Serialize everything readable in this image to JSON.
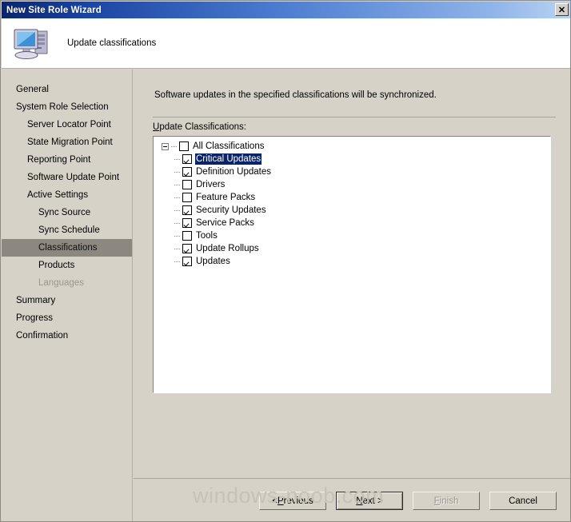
{
  "window": {
    "title": "New Site Role Wizard",
    "close_label": "✕",
    "close_icon": "close-icon"
  },
  "header": {
    "title": "Update classifications",
    "icon": "computer-icon"
  },
  "sidebar": {
    "items": [
      {
        "label": "General",
        "indent": 0,
        "state": "normal"
      },
      {
        "label": "System Role Selection",
        "indent": 0,
        "state": "normal"
      },
      {
        "label": "Server Locator Point",
        "indent": 1,
        "state": "normal"
      },
      {
        "label": "State Migration Point",
        "indent": 1,
        "state": "normal"
      },
      {
        "label": "Reporting Point",
        "indent": 1,
        "state": "normal"
      },
      {
        "label": "Software Update Point",
        "indent": 1,
        "state": "normal"
      },
      {
        "label": "Active Settings",
        "indent": 1,
        "state": "normal"
      },
      {
        "label": "Sync Source",
        "indent": 2,
        "state": "normal"
      },
      {
        "label": "Sync Schedule",
        "indent": 2,
        "state": "normal"
      },
      {
        "label": "Classifications",
        "indent": 2,
        "state": "selected"
      },
      {
        "label": "Products",
        "indent": 2,
        "state": "normal"
      },
      {
        "label": "Languages",
        "indent": 2,
        "state": "disabled"
      },
      {
        "label": "Summary",
        "indent": 0,
        "state": "normal"
      },
      {
        "label": "Progress",
        "indent": 0,
        "state": "normal"
      },
      {
        "label": "Confirmation",
        "indent": 0,
        "state": "normal"
      }
    ]
  },
  "main": {
    "description": "Software updates in the specified classifications will be synchronized.",
    "tree_label_accel": "U",
    "tree_label_rest": "pdate Classifications:",
    "tree": {
      "root": {
        "label": "All Classifications",
        "checked": false,
        "expanded": true
      },
      "children": [
        {
          "label": "Critical Updates",
          "checked": true,
          "selected": true
        },
        {
          "label": "Definition Updates",
          "checked": true,
          "selected": false
        },
        {
          "label": "Drivers",
          "checked": false,
          "selected": false
        },
        {
          "label": "Feature Packs",
          "checked": false,
          "selected": false
        },
        {
          "label": "Security Updates",
          "checked": true,
          "selected": false
        },
        {
          "label": "Service Packs",
          "checked": true,
          "selected": false
        },
        {
          "label": "Tools",
          "checked": false,
          "selected": false
        },
        {
          "label": "Update Rollups",
          "checked": true,
          "selected": false
        },
        {
          "label": "Updates",
          "checked": true,
          "selected": false
        }
      ]
    }
  },
  "footer": {
    "previous": {
      "pre": "< ",
      "accel": "P",
      "post": "revious",
      "disabled": false
    },
    "next": {
      "pre": "",
      "accel": "N",
      "post": "ext >",
      "disabled": false,
      "default": true
    },
    "finish": {
      "pre": "",
      "accel": "F",
      "post": "inish",
      "disabled": true
    },
    "cancel": {
      "pre": "",
      "accel": "",
      "post": "Cancel",
      "disabled": false
    }
  },
  "watermark": {
    "text": "windows-noob.com"
  },
  "colors": {
    "dialog_face": "#d6d2c8",
    "title_start": "#0a246a",
    "title_end": "#b9d3f3",
    "selection": "#0a246a",
    "sidebar_selection": "#8c8880",
    "disabled_text": "#9b968c"
  }
}
